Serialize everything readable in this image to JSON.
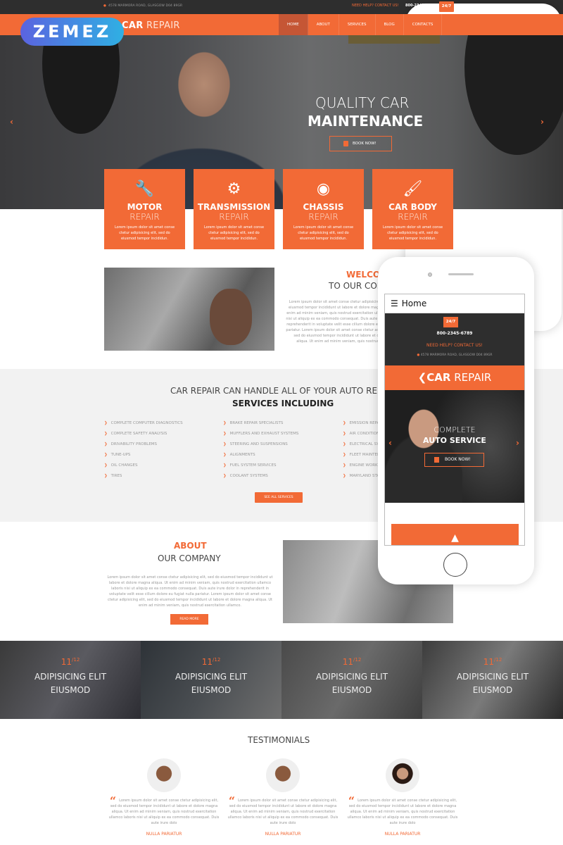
{
  "topbar": {
    "address": "4578 MARMORA ROAD, GLASGOW D04 89GR",
    "help": "NEED HELP? CONTACT US!",
    "phone": "800-2345-6789",
    "badge": "24/7"
  },
  "brand": {
    "bold": "CAR",
    "light": "REPAIR",
    "watermark": "ZEMEZ"
  },
  "nav": [
    "HOME",
    "ABOUT",
    "SERVICES",
    "BLOG",
    "CONTACTS"
  ],
  "hero": {
    "line1": "QUALITY CAR",
    "line2": "MAINTENANCE",
    "button": "BOOK NOW!"
  },
  "cards": [
    {
      "icon": "piston-icon",
      "t1": "MOTOR",
      "t2": "REPAIR",
      "desc": "Lorem ipsum dolor sit amet conse ctetur adipisicing elit, sed do eiusmod tempor incididun."
    },
    {
      "icon": "gears-icon",
      "t1": "TRANSMISSION",
      "t2": "REPAIR",
      "desc": "Lorem ipsum dolor sit amet conse ctetur adipisicing elit, sed do eiusmod tempor incididun."
    },
    {
      "icon": "brake-disc-icon",
      "t1": "CHASSIS",
      "t2": "REPAIR",
      "desc": "Lorem ipsum dolor sit amet conse ctetur adipisicing elit, sed do eiusmod tempor incididun."
    },
    {
      "icon": "paint-brush-icon",
      "t1": "CAR BODY",
      "t2": "REPAIR",
      "desc": "Lorem ipsum dolor sit amet conse ctetur adipisicing elit, sed do eiusmod tempor incididun."
    }
  ],
  "welcome": {
    "h1": "WELCOME",
    "h2": "TO OUR COMPANY",
    "text": "Lorem ipsum dolor sit amet conse ctetur adipisicing elit, sed do eiusmod tempor incididunt ut labore et dolore magna aliqua. Ut enim ad minim veniam, quis nostrud exercitation ullamco laboris nisi ut aliquip ex ea commodo consequat. Duis aute irure dolor in reprehenderit in voluptate velit esse cillum dolore eu fugiat nulla pariatur. Lorem ipsum dolor sit amet conse ctetur adipisicing elit, sed do eiusmod tempor incididunt ut labore et dolore magna aliqua. Ut enim ad minim veniam, quis nostrud exercitation ullamco."
  },
  "services": {
    "h1": "CAR REPAIR CAN HANDLE ALL OF YOUR AUTO REPAIR NEEDS",
    "h2": "SERVICES INCLUDING",
    "col1": [
      "COMPLETE COMPUTER DIAGNOSTICS",
      "COMPLETE SAFETY ANALYSIS",
      "DRIVABILITY PROBLEMS",
      "TUNE-UPS",
      "OIL CHANGES",
      "TIRES"
    ],
    "col2": [
      "BRAKE REPAIR SPECIALISTS",
      "MUFFLERS AND EXHAUST SYSTEMS",
      "STEERING AND SUSPENSIONS",
      "ALIGNMENTS",
      "FUEL SYSTEM SERVICES",
      "COOLANT SYSTEMS"
    ],
    "col3": [
      "EMISSION REPAIR",
      "AIR CONDITIONING",
      "ELECTRICAL SYSTEMS",
      "FLEET MAINTENANCE",
      "ENGINE WORK",
      "MARYLAND STATE INSPECTIONS"
    ],
    "button": "SEE ALL SERVICES"
  },
  "about": {
    "h1": "ABOUT",
    "h2": "OUR COMPANY",
    "text": "Lorem ipsum dolor sit amet conse ctetur adipisicing elit, sed do eiusmod tempor incididunt ut labore et dolore magna aliqua. Ut enim ad minim veniam, quis nostrud exercitation ullamco laboris nisi ut aliquip ex ea commodo consequat. Duis aute irure dolor in reprehenderit in voluptate velit esse cillum dolore eu fugiat nulla pariatur. Lorem ipsum dolor sit amet conse ctetur adipisicing elit, sed do eiusmod tempor incididunt ut labore et dolore magna aliqua. Ut enim ad minim veniam, quis nostrud exercitation ullamco.",
    "button": "READ MORE"
  },
  "news": [
    {
      "day": "11",
      "month": "12",
      "l1": "ADIPISICING ELIT",
      "l2": "EIUSMOD"
    },
    {
      "day": "11",
      "month": "12",
      "l1": "ADIPISICING ELIT",
      "l2": "EIUSMOD"
    },
    {
      "day": "11",
      "month": "12",
      "l1": "ADIPISICING ELIT",
      "l2": "EIUSMOD"
    },
    {
      "day": "11",
      "month": "12",
      "l1": "ADIPISICING ELIT",
      "l2": "EIUSMOD"
    }
  ],
  "testimonials": {
    "title": "TESTIMONIALS",
    "items": [
      {
        "quote": "Lorem ipsum dolor sit amet conse ctetur adipisicing elit, sed do eiusmod tempor incididunt ut labore et dolore magna aliqua. Ut enim ad minim veniam, quis nostrud exercitation ullamco laboris nisi ut aliquip ex ea commodo consequat. Duis aute irure dolo",
        "name": "NULLA PARIATUR"
      },
      {
        "quote": "Lorem ipsum dolor sit amet conse ctetur adipisicing elit, sed do eiusmod tempor incididunt ut labore et dolore magna aliqua. Ut enim ad minim veniam, quis nostrud exercitation ullamco laboris nisi ut aliquip ex ea commodo consequat. Duis aute irure dolo",
        "name": "NULLA PARIATUR"
      },
      {
        "quote": "Lorem ipsum dolor sit amet conse ctetur adipisicing elit, sed do eiusmod tempor incididunt ut labore et dolore magna aliqua. Ut enim ad minim veniam, quis nostrud exercitation ullamco laboris nisi ut aliquip ex ea commodo consequat. Duis aute irure dolo",
        "name": "NULLA PARIATUR"
      }
    ]
  },
  "mobile": {
    "menu": "Home",
    "badge": "24/7",
    "phone": "800-2345-6789",
    "help": "NEED HELP? CONTACT US!",
    "address": "4578 MARMORA ROAD, GLASGOW D04 89GR",
    "brand_bold": "CAR",
    "brand_light": "REPAIR",
    "hero1": "COMPLETE",
    "hero2": "AUTO SERVICE",
    "button": "BOOK NOW!"
  },
  "colors": {
    "accent": "#f26a36",
    "dark": "#2e2e2e",
    "nav_active": "#c55635"
  }
}
